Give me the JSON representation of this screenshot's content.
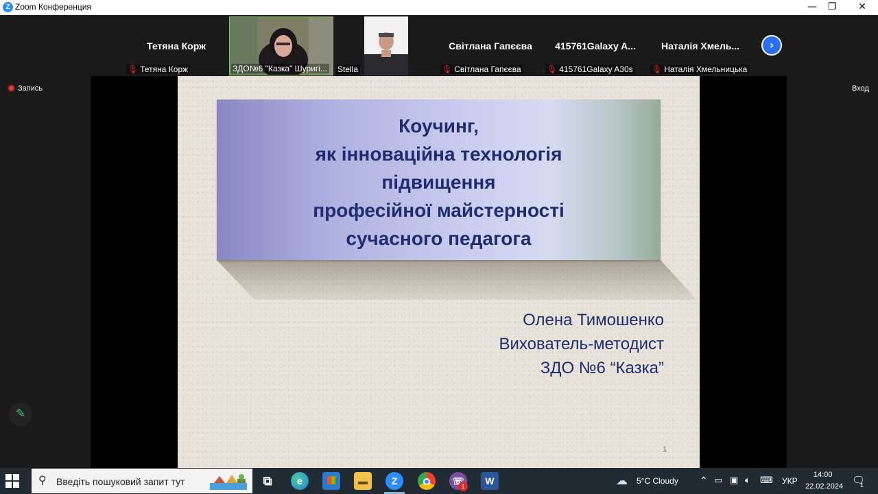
{
  "window": {
    "title": "Zoom Конференция",
    "logo_letter": "Z",
    "minimize": "—",
    "restore": "❐",
    "close": "✕"
  },
  "participants": [
    {
      "big_name": "Тетяна Корж",
      "label": "Тетяна Корж",
      "muted": true
    },
    {
      "big_name": "",
      "label": "ЗДО№6 \"Казка\" Шуригі...",
      "muted": false
    },
    {
      "big_name": "",
      "label": "Stella",
      "muted": false
    },
    {
      "big_name": "Світлана Гапєєва",
      "label": "Світлана Гапєєва",
      "muted": true
    },
    {
      "big_name": "415761Galaxy A...",
      "label": "415761Galaxy A30s",
      "muted": true
    },
    {
      "big_name": "Наталія Хмель...",
      "label": "Наталія Хмельницька",
      "muted": true
    }
  ],
  "next_arrow": "›",
  "recording_label": "Запись",
  "view_label": "Вход",
  "slide": {
    "title_lines": [
      "Коучинг,",
      "як інноваційна технологія",
      "підвищення",
      "професійної майстерності",
      "сучасного педагога"
    ],
    "author_name": "Олена Тимошенко",
    "author_role": "Вихователь-методист",
    "author_org": "ЗДО №6 “Казка”",
    "page_number": "1"
  },
  "taskbar": {
    "search_placeholder": "Введіть пошуковий запит тут",
    "weather": "5°C  Cloudy",
    "language": "УКР",
    "time": "14:00",
    "date": "22.02.2024",
    "notification_count": "1",
    "viber_badge": "1",
    "icons": [
      "task-view-icon",
      "edge-icon",
      "store-icon",
      "file-explorer-icon",
      "zoom-icon",
      "chrome-icon",
      "viber-icon",
      "word-icon"
    ]
  },
  "colors": {
    "zoom_blue": "#2d8cff",
    "slide_title": "#1f2d6e",
    "muted_red": "#e02828",
    "taskbar": "#202b33"
  }
}
